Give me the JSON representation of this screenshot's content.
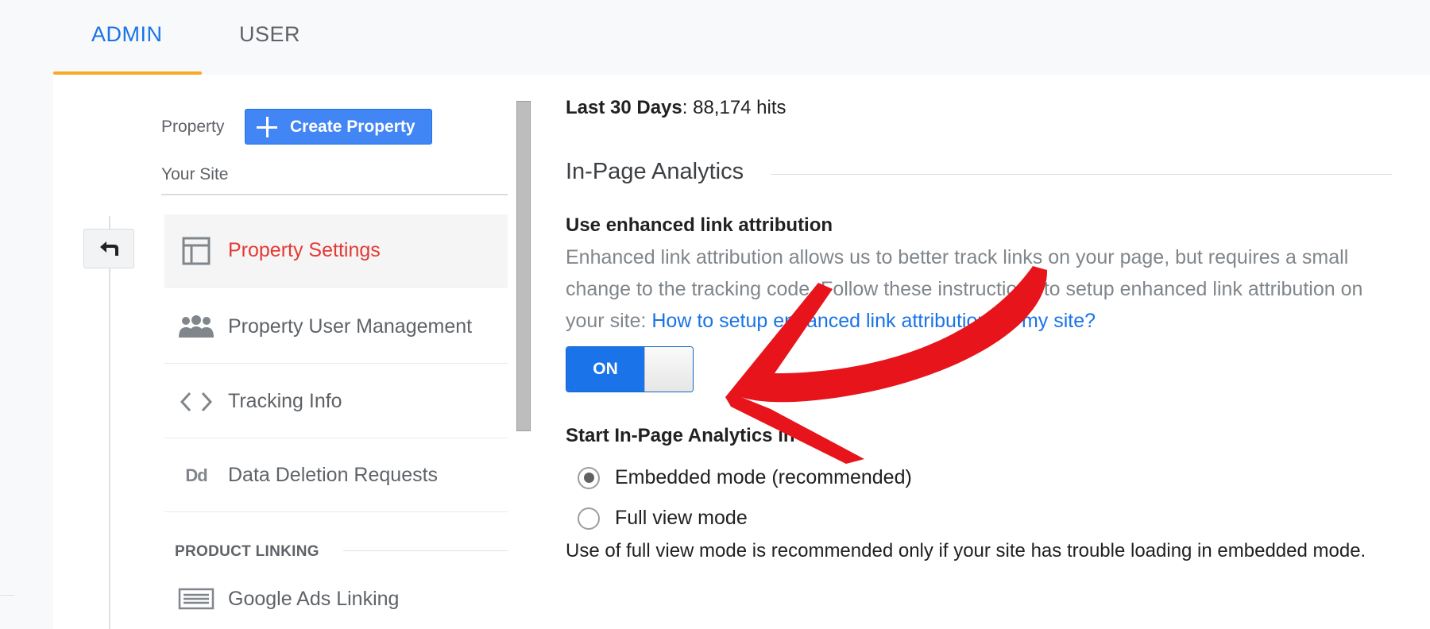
{
  "tabs": [
    {
      "label": "ADMIN",
      "active": true
    },
    {
      "label": "USER",
      "active": false
    }
  ],
  "sidebar": {
    "property_label": "Property",
    "create_button": "Create Property",
    "site_name": "Your Site",
    "items": [
      {
        "label": "Property Settings",
        "icon": "layout-icon",
        "active": true
      },
      {
        "label": "Property User Management",
        "icon": "people-icon",
        "active": false
      },
      {
        "label": "Tracking Info",
        "icon": "code-icon",
        "active": false
      },
      {
        "label": "Data Deletion Requests",
        "icon": "dd-icon",
        "active": false
      },
      {
        "label": "Google Ads Linking",
        "icon": "ads-linking-icon",
        "active": false
      }
    ],
    "section_product_linking": "PRODUCT LINKING",
    "dd_icon_text": "Dd"
  },
  "main": {
    "hits_label": "Last 30 Days",
    "hits_value": ": 88,174 hits",
    "ipa_title": "In-Page Analytics",
    "ela_heading": "Use enhanced link attribution",
    "ela_desc": "Enhanced link attribution allows us to better track links on your page, but requires a small change to the tracking code. Follow these instructions to setup enhanced link attribution on your site: ",
    "ela_link": "How to setup enhanced link attribution on my site?",
    "toggle_label": "ON",
    "toggle_state": true,
    "start_heading": "Start In-Page Analytics in",
    "modes": [
      {
        "label": "Embedded mode (recommended)",
        "selected": true
      },
      {
        "label": "Full view mode",
        "selected": false
      }
    ],
    "note": "Use of full view mode is recommended only if your site has trouble loading in embedded mode."
  },
  "colors": {
    "accent": "#1a73e8",
    "active_nav": "#e53935",
    "tab_underline": "#f9a825",
    "annotation_arrow": "#e8141b"
  }
}
